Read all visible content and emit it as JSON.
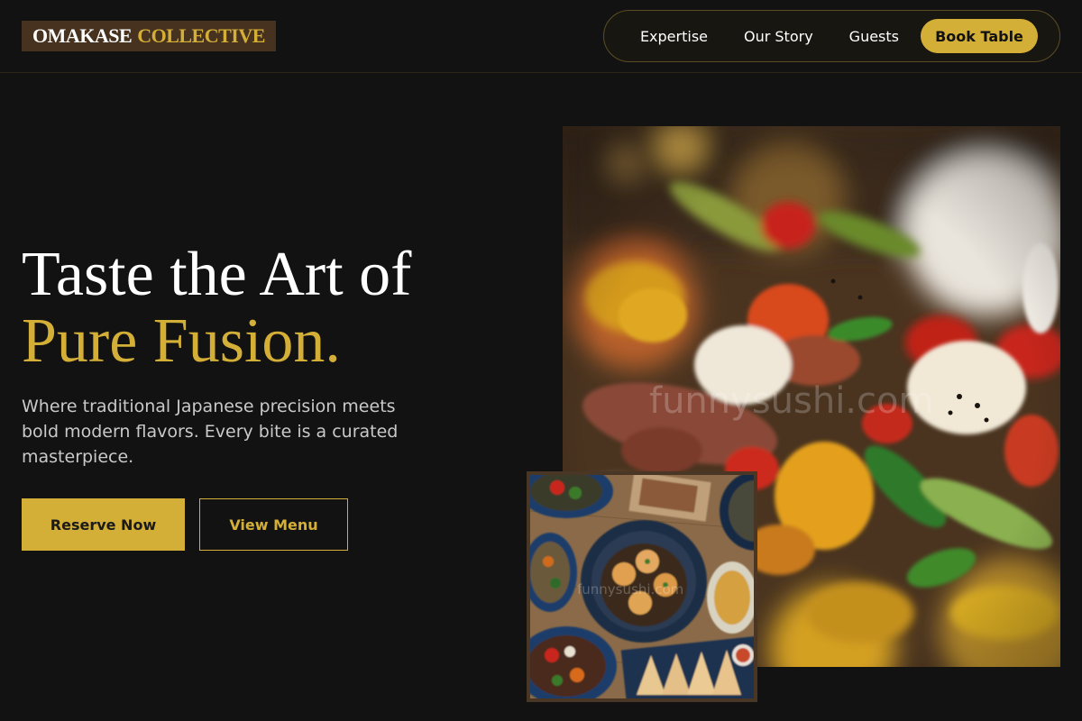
{
  "brand": {
    "name_part1": "OMAKASE",
    "name_part2": "COLLECTIVE",
    "accent_color": "#d4af37",
    "background_color": "#121212"
  },
  "nav": {
    "links": [
      "Expertise",
      "Our Story",
      "Guests"
    ],
    "cta_label": "Book Table"
  },
  "hero": {
    "headline_line1": "Taste the Art of",
    "headline_line2": "Pure Fusion.",
    "subtitle": "Where traditional Japanese precision meets bold modern flavors. Every bite is a curated masterpiece.",
    "primary_button": "Reserve Now",
    "secondary_button": "View Menu"
  },
  "images": {
    "main_watermark": "funnysushi.com",
    "thumb_watermark": "funnysushi.com"
  }
}
